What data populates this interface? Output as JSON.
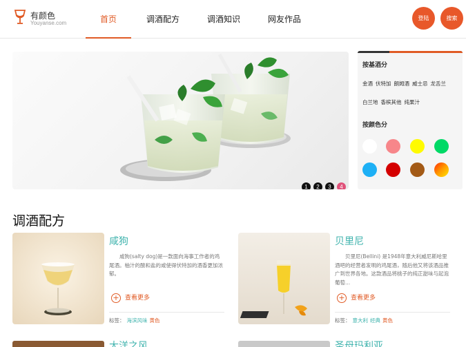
{
  "brand": {
    "name": "有颜色",
    "site": "Youyanse.com",
    "accent": "#e05a24",
    "teal": "#3fb3ad"
  },
  "nav": {
    "items": [
      {
        "label": "首页",
        "active": true
      },
      {
        "label": "调酒配方",
        "active": false
      },
      {
        "label": "调酒知识",
        "active": false
      },
      {
        "label": "网友作品",
        "active": false
      }
    ],
    "login_label": "登陆",
    "search_label": "搜索"
  },
  "carousel": {
    "dots": [
      "1",
      "2",
      "3",
      "4"
    ],
    "active_index": 3
  },
  "sidebar": {
    "base_title": "按基酒分",
    "base_tags": [
      "金酒",
      "伏特加",
      "朗姆酒",
      "威士忌",
      "龙舌兰",
      "白兰地",
      "香槟其他",
      "纯果汁"
    ],
    "color_title": "按颜色分",
    "colors": [
      "#ffffff",
      "#f7868a",
      "#fffb00",
      "#00d966",
      "#1eb0f5",
      "#d40000",
      "#a35a16",
      "gradient-orange"
    ]
  },
  "recipes": {
    "section_title": "调酒配方",
    "more_label": "查看更多",
    "tag_prefix": "标签：",
    "cards": [
      {
        "title": "咸狗",
        "desc": "咸狗(salty dog)是一款面向海事工作者的鸡尾酒。柚汁的酸和盐的咸使得伏特加的酒香更加浓郁。",
        "tags": [
          "海滨风味",
          "黄色"
        ]
      },
      {
        "title": "贝里尼",
        "desc": "贝里尼(Bellini) 是1948年意大利威尼斯哈里酒吧的经营者发明的鸡尾酒，随后他又将该酒品推广到世界各地。这款酒品将桃子的纯正甜味与起泡葡萄...",
        "tags": [
          "意大利",
          "经典",
          "黄色"
        ]
      }
    ],
    "next_titles": [
      "大洋之风",
      "圣母玛利亚"
    ]
  }
}
